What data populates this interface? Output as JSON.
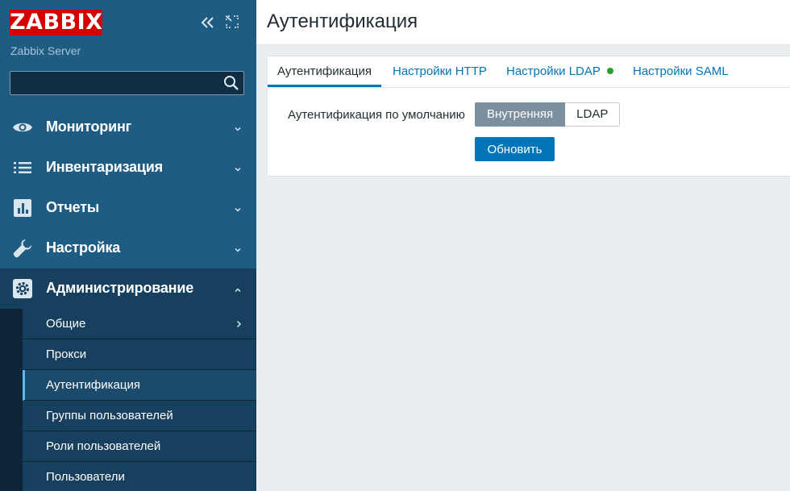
{
  "sidebar": {
    "logo_text": "ZABBIX",
    "server_name": "Zabbix Server",
    "search": {
      "value": "",
      "placeholder": ""
    },
    "menu": [
      {
        "label": "Мониторинг",
        "icon": "eye-icon"
      },
      {
        "label": "Инвентаризация",
        "icon": "list-icon"
      },
      {
        "label": "Отчеты",
        "icon": "bar-chart-icon"
      },
      {
        "label": "Настройка",
        "icon": "wrench-icon"
      },
      {
        "label": "Администрирование",
        "icon": "gear-icon",
        "expanded": true
      }
    ],
    "submenu": [
      {
        "label": "Общие"
      },
      {
        "label": "Прокси"
      },
      {
        "label": "Аутентификация",
        "selected": true
      },
      {
        "label": "Группы пользователей"
      },
      {
        "label": "Роли пользователей"
      },
      {
        "label": "Пользователи"
      }
    ]
  },
  "page": {
    "title": "Аутентификация",
    "tabs": [
      {
        "label": "Аутентификация",
        "active": true
      },
      {
        "label": "Настройки HTTP"
      },
      {
        "label": "Настройки LDAP",
        "status": "enabled"
      },
      {
        "label": "Настройки SAML"
      }
    ],
    "form": {
      "default_auth_label": "Аутентификация по умолчанию",
      "options": [
        "Внутренняя",
        "LDAP"
      ],
      "selected_option": "Внутренняя",
      "submit_label": "Обновить"
    }
  },
  "colors": {
    "sidebar_bg": "#1f5c84",
    "logo_red": "#d40000",
    "accent_blue": "#0275b8",
    "status_green": "#2ca02c"
  }
}
